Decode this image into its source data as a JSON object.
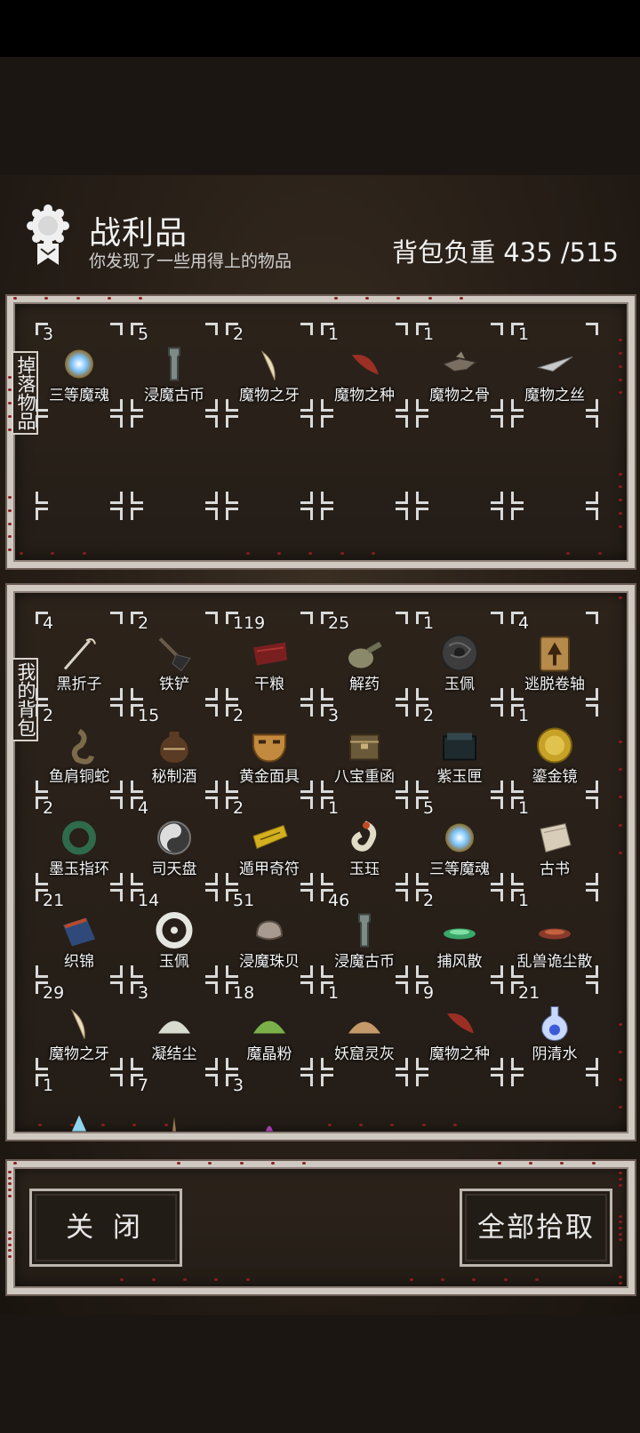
{
  "header": {
    "title": "战利品",
    "subtitle": "你发现了一些用得上的物品",
    "weight_label": "背包负重",
    "weight_value": "435 /515"
  },
  "drop_panel": {
    "label": "掉落物品",
    "items": [
      {
        "count": "3",
        "name": "三等魔魂",
        "icon": "glowing-orb-icon"
      },
      {
        "count": "5",
        "name": "浸魔古币",
        "icon": "ancient-spade-coin-icon"
      },
      {
        "count": "2",
        "name": "魔物之牙",
        "icon": "fang-icon"
      },
      {
        "count": "1",
        "name": "魔物之种",
        "icon": "seed-icon"
      },
      {
        "count": "1",
        "name": "魔物之骨",
        "icon": "bone-icon"
      },
      {
        "count": "1",
        "name": "魔物之丝",
        "icon": "silk-blade-icon"
      }
    ],
    "empty_slots": 12
  },
  "bag_panel": {
    "label": "我的背包",
    "items": [
      {
        "count": "4",
        "name": "黑折子",
        "icon": "fire-stick-icon"
      },
      {
        "count": "2",
        "name": "铁铲",
        "icon": "shovel-icon"
      },
      {
        "count": "119",
        "name": "干粮",
        "icon": "jerky-icon"
      },
      {
        "count": "25",
        "name": "解药",
        "icon": "gourd-icon"
      },
      {
        "count": "1",
        "name": "玉佩",
        "icon": "dragon-jade-disc-icon"
      },
      {
        "count": "4",
        "name": "逃脱卷轴",
        "icon": "escape-scroll-icon"
      },
      {
        "count": "2",
        "name": "鱼肩铜蛇",
        "icon": "bronze-snake-icon"
      },
      {
        "count": "15",
        "name": "秘制酒",
        "icon": "wine-jar-icon"
      },
      {
        "count": "2",
        "name": "黄金面具",
        "icon": "gold-mask-icon"
      },
      {
        "count": "3",
        "name": "八宝重函",
        "icon": "treasure-box-icon"
      },
      {
        "count": "2",
        "name": "紫玉匣",
        "icon": "jade-casket-icon"
      },
      {
        "count": "1",
        "name": "鎏金镜",
        "icon": "gilded-mirror-icon"
      },
      {
        "count": "2",
        "name": "墨玉指环",
        "icon": "jade-ring-icon"
      },
      {
        "count": "4",
        "name": "司天盘",
        "icon": "bagua-compass-icon"
      },
      {
        "count": "2",
        "name": "遁甲奇符",
        "icon": "talisman-icon"
      },
      {
        "count": "1",
        "name": "玉珏",
        "icon": "jade-dragon-icon"
      },
      {
        "count": "5",
        "name": "三等魔魂",
        "icon": "glowing-orb-icon"
      },
      {
        "count": "1",
        "name": "古书",
        "icon": "old-book-icon"
      },
      {
        "count": "21",
        "name": "织锦",
        "icon": "brocade-icon"
      },
      {
        "count": "14",
        "name": "玉佩",
        "icon": "white-jade-pendant-icon"
      },
      {
        "count": "51",
        "name": "浸魔珠贝",
        "icon": "shell-icon"
      },
      {
        "count": "46",
        "name": "浸魔古币",
        "icon": "ancient-spade-coin-icon"
      },
      {
        "count": "2",
        "name": "捕风散",
        "icon": "green-powder-dish-icon"
      },
      {
        "count": "1",
        "name": "乱兽诡尘散",
        "icon": "red-powder-dish-icon"
      },
      {
        "count": "29",
        "name": "魔物之牙",
        "icon": "fang-icon"
      },
      {
        "count": "3",
        "name": "凝结尘",
        "icon": "white-dust-icon"
      },
      {
        "count": "18",
        "name": "魔晶粉",
        "icon": "green-crystal-powder-icon"
      },
      {
        "count": "1",
        "name": "妖窟灵灰",
        "icon": "ash-pile-icon"
      },
      {
        "count": "9",
        "name": "魔物之种",
        "icon": "seed-icon"
      },
      {
        "count": "21",
        "name": "阴清水",
        "icon": "potion-flask-icon"
      },
      {
        "count": "1",
        "name": "",
        "icon": "blue-crystal-icon"
      },
      {
        "count": "7",
        "name": "",
        "icon": "incense-icon"
      },
      {
        "count": "3",
        "name": "",
        "icon": "purple-potion-icon"
      },
      {
        "count": "",
        "name": "",
        "icon": ""
      },
      {
        "count": "",
        "name": "",
        "icon": ""
      },
      {
        "count": "",
        "name": "",
        "icon": ""
      }
    ]
  },
  "buttons": {
    "close_label": "关 闭",
    "pickall_label": "全部拾取"
  }
}
